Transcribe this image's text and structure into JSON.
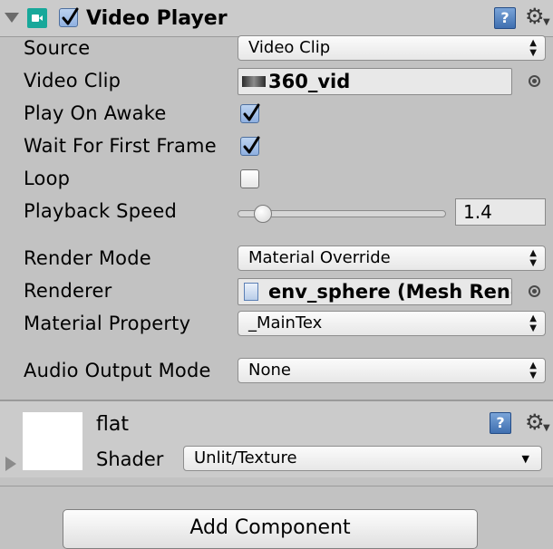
{
  "component": {
    "title": "Video Player",
    "enabled": true
  },
  "properties": {
    "source": {
      "label": "Source",
      "value": "Video Clip"
    },
    "video_clip": {
      "label": "Video Clip",
      "value": "360_vid"
    },
    "play_on_awake": {
      "label": "Play On Awake",
      "checked": true
    },
    "wait_for_first_frame": {
      "label": "Wait For First Frame",
      "checked": true
    },
    "loop": {
      "label": "Loop",
      "checked": false
    },
    "playback_speed": {
      "label": "Playback Speed",
      "value": "1.4",
      "slider_fraction": 0.12
    },
    "render_mode": {
      "label": "Render Mode",
      "value": "Material Override"
    },
    "renderer": {
      "label": "Renderer",
      "value": "env_sphere (Mesh Renderer)"
    },
    "material_property": {
      "label": "Material Property",
      "value": "_MainTex"
    },
    "audio_output_mode": {
      "label": "Audio Output Mode",
      "value": "None"
    }
  },
  "material": {
    "name": "flat",
    "shader_label": "Shader",
    "shader_value": "Unlit/Texture"
  },
  "add_component_label": "Add Component",
  "icons": {
    "foldout": "foldout-down-icon",
    "component": "video-player-icon",
    "help": "help-book-icon",
    "settings": "gear-icon",
    "object_picker": "object-picker-icon"
  },
  "colors": {
    "background": "#c2c2c2",
    "header": "#cbcbcb",
    "component_icon": "#17a89a",
    "check_fill": "#8fb0e0"
  }
}
